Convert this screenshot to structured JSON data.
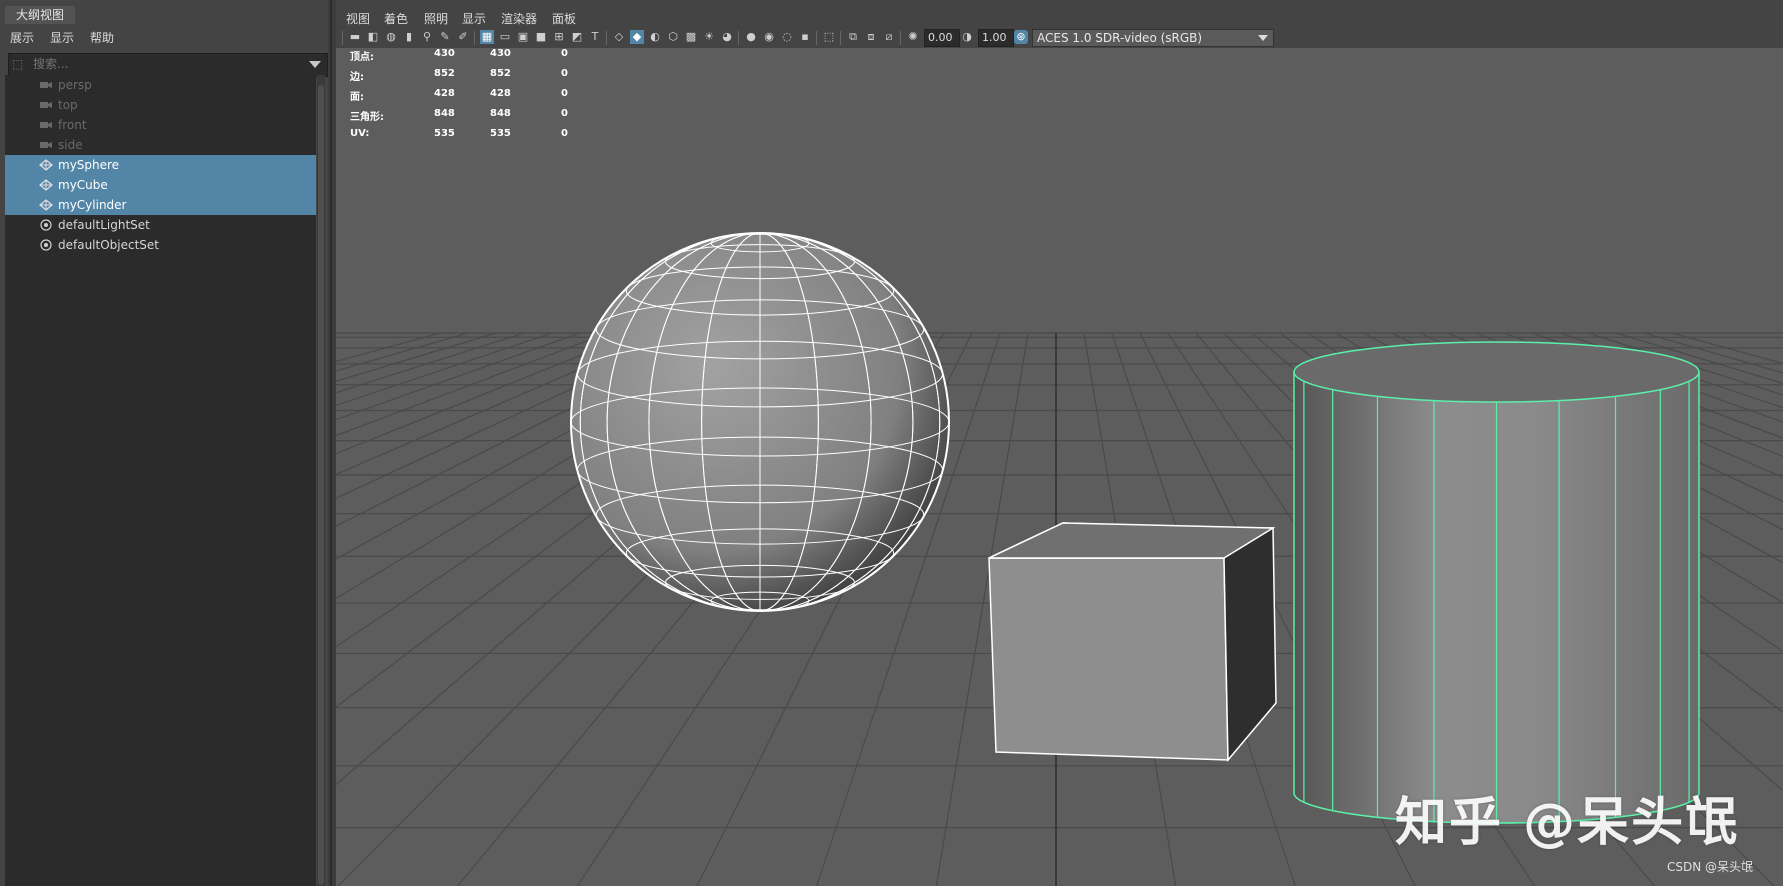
{
  "outliner": {
    "tab_title": "大纲视图",
    "menu": [
      "展示",
      "显示",
      "帮助"
    ],
    "search_placeholder": "搜索...",
    "items": [
      {
        "label": "persp",
        "kind": "camera",
        "state": "dim"
      },
      {
        "label": "top",
        "kind": "camera",
        "state": "dim"
      },
      {
        "label": "front",
        "kind": "camera",
        "state": "dim"
      },
      {
        "label": "side",
        "kind": "camera",
        "state": "dim"
      },
      {
        "label": "mySphere",
        "kind": "mesh",
        "state": "selected"
      },
      {
        "label": "myCube",
        "kind": "mesh",
        "state": "selected"
      },
      {
        "label": "myCylinder",
        "kind": "mesh",
        "state": "selected"
      },
      {
        "label": "defaultLightSet",
        "kind": "set",
        "state": "normal"
      },
      {
        "label": "defaultObjectSet",
        "kind": "set",
        "state": "normal"
      }
    ]
  },
  "viewport": {
    "menu": [
      "视图",
      "着色",
      "照明",
      "显示",
      "渲染器",
      "面板"
    ],
    "toolbar": {
      "value_a": "0.00",
      "value_b": "1.00",
      "colorspace": "ACES 1.0 SDR-video (sRGB)"
    },
    "hud": [
      {
        "label": "顶点:",
        "a": "430",
        "b": "430",
        "c": "0"
      },
      {
        "label": "边:",
        "a": "852",
        "b": "852",
        "c": "0"
      },
      {
        "label": "面:",
        "a": "428",
        "b": "428",
        "c": "0"
      },
      {
        "label": "三角形:",
        "a": "848",
        "b": "848",
        "c": "0"
      },
      {
        "label": "UV:",
        "a": "535",
        "b": "535",
        "c": "0"
      }
    ]
  },
  "watermark": "知乎 @呆头氓",
  "credit": "CSDN @呆头氓",
  "colors": {
    "selection": "#5285a6",
    "viewport_bg": "#5d5d5d",
    "wire_white": "#ffffff",
    "wire_green": "#5bf0a8"
  }
}
